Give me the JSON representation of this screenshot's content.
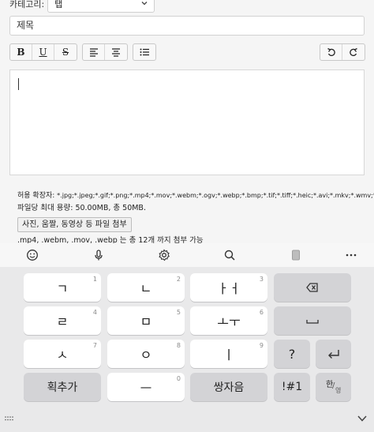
{
  "form": {
    "category_label": "카테고리:",
    "category_value": "탭",
    "title_placeholder": "제목",
    "toolbar": {
      "bold": "B",
      "underline": "U",
      "strike": "S"
    },
    "attach": {
      "allowed_label": "허용 확장자:",
      "allowed_exts": "*.jpg;*.jpeg;*.gif;*.png;*.mp4;*.mov;*.webm;*.ogv;*.webp;*.bmp;*.tif;*.tiff;*.heic;*.avi;*.mkv;*.wmv;*.asf;",
      "max_size": "파일당 최대 용량: 50.00MB, 총 50MB.",
      "button": "사진, 움짤, 동영상 등 파일 첨부",
      "note": ".mp4, .webm, .mov, .webp 는 총 12개 까지 첨부 가능"
    }
  },
  "keyboard": {
    "row1": [
      {
        "label": "ㄱ",
        "num": "1"
      },
      {
        "label": "ㄴ",
        "num": "2"
      },
      {
        "label": "ㅏㅓ",
        "num": "3"
      }
    ],
    "row2": [
      {
        "label": "ㄹ",
        "num": "4"
      },
      {
        "label": "ㅁ",
        "num": "5"
      },
      {
        "label": "ㅗㅜ",
        "num": "6"
      }
    ],
    "row3": [
      {
        "label": "ㅅ",
        "num": "7"
      },
      {
        "label": "ㅇ",
        "num": "8"
      },
      {
        "label": "ㅣ",
        "num": "9"
      }
    ],
    "question": "?",
    "row4": {
      "add_stroke": "획추가",
      "dash": "ㅡ",
      "dash_num": "0",
      "double": "쌍자음",
      "symbols": "!#1",
      "lang_top": "한",
      "lang_bottom": "영"
    }
  }
}
